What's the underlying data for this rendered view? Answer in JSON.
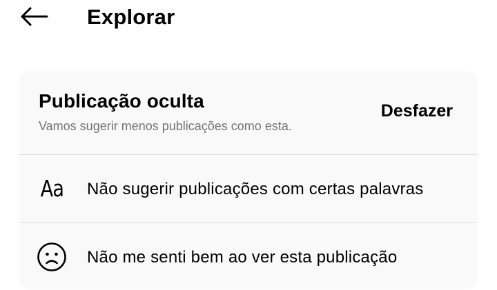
{
  "header": {
    "title": "Explorar",
    "back_icon": "arrow-left-icon"
  },
  "hidden_post": {
    "title": "Publicação oculta",
    "subtitle": "Vamos sugerir menos publicações como esta.",
    "undo_label": "Desfazer"
  },
  "options": [
    {
      "icon": "text-aa-icon",
      "icon_text": "Aa",
      "label": "Não sugerir publicações com certas palavras"
    },
    {
      "icon": "sad-face-icon",
      "label": "Não me senti bem ao ver esta publicação"
    }
  ],
  "colors": {
    "card_background": "#f9f9f9",
    "divider": "#dbdbdb",
    "secondary_text": "#737373",
    "text": "#000000"
  }
}
